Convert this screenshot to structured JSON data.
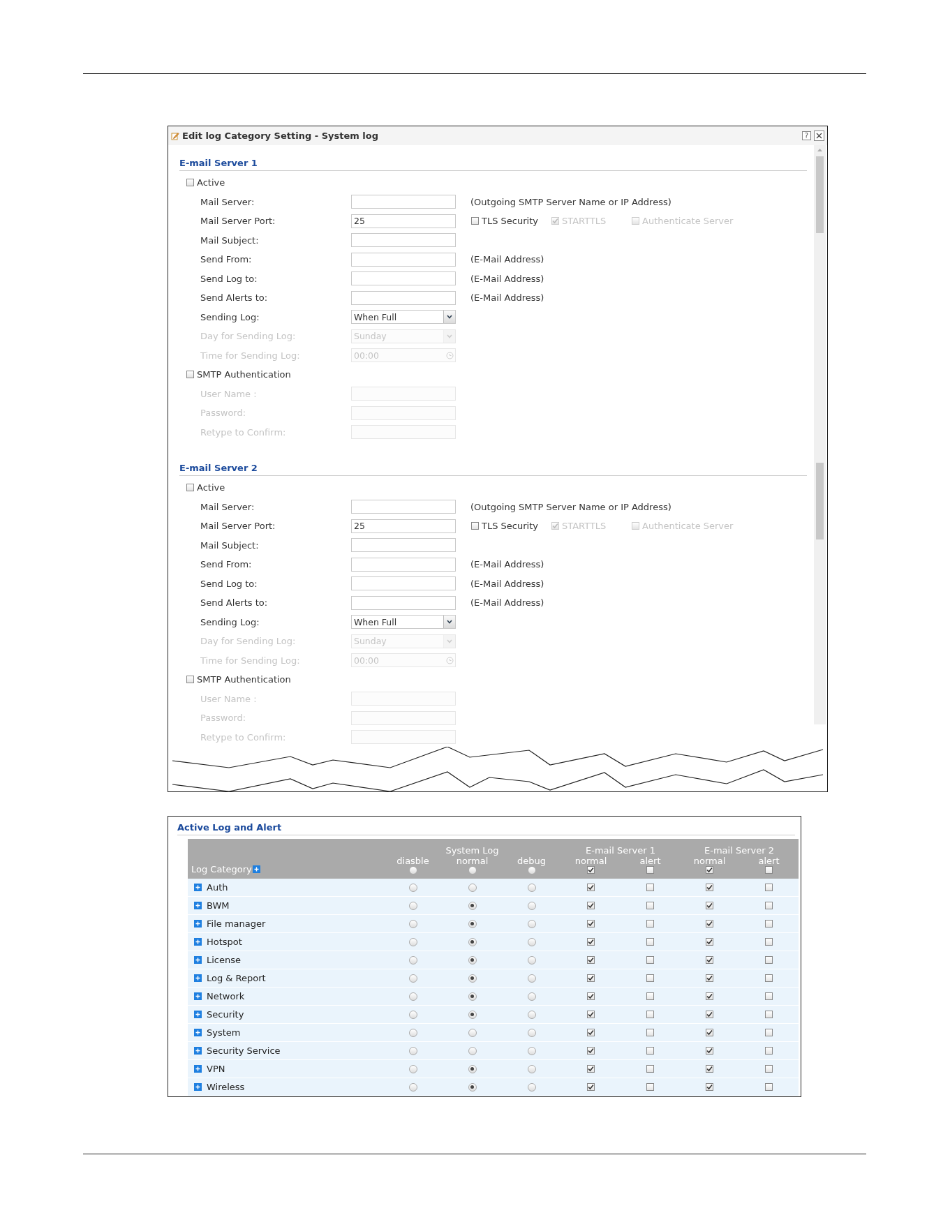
{
  "dialog": {
    "title": "Edit log Category Setting - System log",
    "help_button": "?",
    "servers": [
      {
        "heading": "E-mail Server 1",
        "rows": [
          {
            "kind": "checkbox",
            "label": "Active",
            "checked": false
          },
          {
            "kind": "text",
            "label": "Mail Server:",
            "disabled": false,
            "note": "(Outgoing SMTP Server Name or IP Address)"
          },
          {
            "kind": "text",
            "label": "Mail Server Port:",
            "disabled": false,
            "value": "25",
            "options": [
              {
                "label": "TLS Security",
                "checked": false,
                "disabled": false
              },
              {
                "label": "STARTTLS",
                "checked": true,
                "disabled": true
              },
              {
                "label": "Authenticate Server",
                "checked": false,
                "disabled": true
              }
            ]
          },
          {
            "kind": "text",
            "label": "Mail Subject:",
            "disabled": false
          },
          {
            "kind": "text",
            "label": "Send From:",
            "disabled": false,
            "note": "(E-Mail Address)"
          },
          {
            "kind": "text",
            "label": "Send Log to:",
            "disabled": false,
            "note": "(E-Mail Address)"
          },
          {
            "kind": "text",
            "label": "Send Alerts to:",
            "disabled": false,
            "note": "(E-Mail Address)"
          },
          {
            "kind": "select",
            "label": "Sending Log:",
            "disabled": false,
            "value": "When Full"
          },
          {
            "kind": "select",
            "label": "Day for Sending Log:",
            "disabled": true,
            "value": "Sunday"
          },
          {
            "kind": "time",
            "label": "Time for Sending Log:",
            "disabled": true,
            "value": "00:00"
          },
          {
            "kind": "checkbox",
            "label": "SMTP Authentication",
            "checked": false
          },
          {
            "kind": "text",
            "label": "User Name :",
            "disabled": true
          },
          {
            "kind": "text",
            "label": "Password:",
            "disabled": true
          },
          {
            "kind": "text",
            "label": "Retype to Confirm:",
            "disabled": true
          }
        ]
      },
      {
        "heading": "E-mail Server 2",
        "rows": [
          {
            "kind": "checkbox",
            "label": "Active",
            "checked": false
          },
          {
            "kind": "text",
            "label": "Mail Server:",
            "disabled": false,
            "note": "(Outgoing SMTP Server Name or IP Address)"
          },
          {
            "kind": "text",
            "label": "Mail Server Port:",
            "disabled": false,
            "value": "25",
            "options": [
              {
                "label": "TLS Security",
                "checked": false,
                "disabled": false
              },
              {
                "label": "STARTTLS",
                "checked": true,
                "disabled": true
              },
              {
                "label": "Authenticate Server",
                "checked": false,
                "disabled": true
              }
            ]
          },
          {
            "kind": "text",
            "label": "Mail Subject:",
            "disabled": false
          },
          {
            "kind": "text",
            "label": "Send From:",
            "disabled": false,
            "note": "(E-Mail Address)"
          },
          {
            "kind": "text",
            "label": "Send Log to:",
            "disabled": false,
            "note": "(E-Mail Address)"
          },
          {
            "kind": "text",
            "label": "Send Alerts to:",
            "disabled": false,
            "note": "(E-Mail Address)"
          },
          {
            "kind": "select",
            "label": "Sending Log:",
            "disabled": false,
            "value": "When Full"
          },
          {
            "kind": "select",
            "label": "Day for Sending Log:",
            "disabled": true,
            "value": "Sunday"
          },
          {
            "kind": "time",
            "label": "Time for Sending Log:",
            "disabled": true,
            "value": "00:00"
          },
          {
            "kind": "checkbox",
            "label": "SMTP Authentication",
            "checked": false
          },
          {
            "kind": "text",
            "label": "User Name :",
            "disabled": true
          },
          {
            "kind": "text",
            "label": "Password:",
            "disabled": true
          },
          {
            "kind": "text",
            "label": "Retype to Confirm:",
            "disabled": true
          }
        ]
      }
    ]
  },
  "log_table": {
    "title": "Active Log and Alert",
    "category_header": "Log Category",
    "groups": [
      {
        "label": "System Log",
        "columns": [
          "diasble",
          "normal",
          "debug"
        ]
      },
      {
        "label": "E-mail Server 1",
        "columns": [
          "normal",
          "alert"
        ]
      },
      {
        "label": "E-mail Server 2",
        "columns": [
          "normal",
          "alert"
        ]
      }
    ],
    "header_radios": [
      false,
      false,
      false
    ],
    "header_checks": [
      true,
      false,
      true,
      false
    ],
    "rows": [
      {
        "category": "Auth",
        "radios": [
          false,
          false,
          false
        ],
        "checks": [
          true,
          false,
          true,
          false
        ]
      },
      {
        "category": "BWM",
        "radios": [
          false,
          true,
          false
        ],
        "checks": [
          true,
          false,
          true,
          false
        ]
      },
      {
        "category": "File manager",
        "radios": [
          false,
          true,
          false
        ],
        "checks": [
          true,
          false,
          true,
          false
        ]
      },
      {
        "category": "Hotspot",
        "radios": [
          false,
          true,
          false
        ],
        "checks": [
          true,
          false,
          true,
          false
        ]
      },
      {
        "category": "License",
        "radios": [
          false,
          true,
          false
        ],
        "checks": [
          true,
          false,
          true,
          false
        ]
      },
      {
        "category": "Log & Report",
        "radios": [
          false,
          true,
          false
        ],
        "checks": [
          true,
          false,
          true,
          false
        ]
      },
      {
        "category": "Network",
        "radios": [
          false,
          true,
          false
        ],
        "checks": [
          true,
          false,
          true,
          false
        ]
      },
      {
        "category": "Security",
        "radios": [
          false,
          true,
          false
        ],
        "checks": [
          true,
          false,
          true,
          false
        ]
      },
      {
        "category": "System",
        "radios": [
          false,
          false,
          false
        ],
        "checks": [
          true,
          false,
          true,
          false
        ]
      },
      {
        "category": "Security Service",
        "radios": [
          false,
          false,
          false
        ],
        "checks": [
          true,
          false,
          true,
          false
        ]
      },
      {
        "category": "VPN",
        "radios": [
          false,
          true,
          false
        ],
        "checks": [
          true,
          false,
          true,
          false
        ]
      },
      {
        "category": "Wireless",
        "radios": [
          false,
          true,
          false
        ],
        "checks": [
          true,
          false,
          true,
          false
        ]
      }
    ]
  }
}
